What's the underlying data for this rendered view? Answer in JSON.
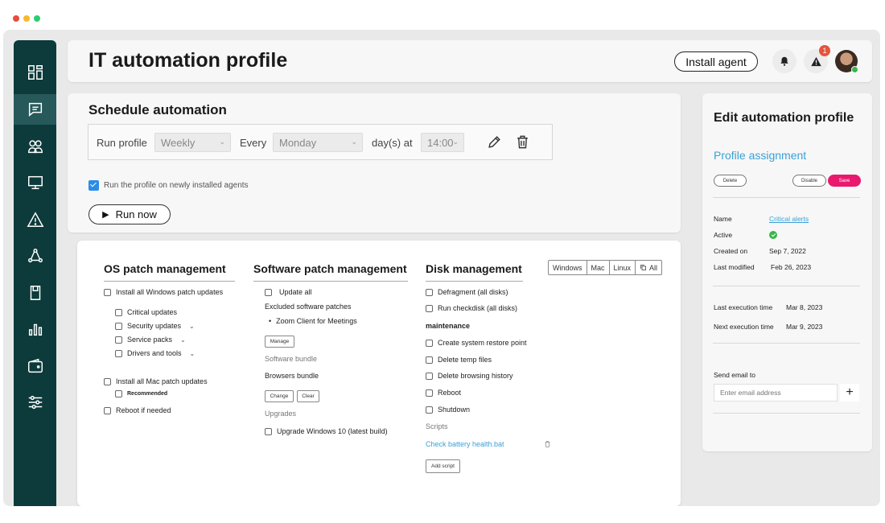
{
  "window": {
    "dot_colors": [
      "#e84c3d",
      "#f5b82e",
      "#2ecc71"
    ]
  },
  "sidebar": {
    "items": [
      {
        "name": "dashboard-icon",
        "active": false
      },
      {
        "name": "chat-icon",
        "active": true
      },
      {
        "name": "users-icon",
        "active": false
      },
      {
        "name": "monitor-icon",
        "active": false
      },
      {
        "name": "alert-icon",
        "active": false
      },
      {
        "name": "network-icon",
        "active": false
      },
      {
        "name": "storage-icon",
        "active": false
      },
      {
        "name": "reports-icon",
        "active": false
      },
      {
        "name": "wallet-icon",
        "active": false
      },
      {
        "name": "settings-sliders-icon",
        "active": false
      }
    ]
  },
  "header": {
    "title": "IT automation profile",
    "install_label": "Install agent",
    "alert_badge": "1"
  },
  "schedule": {
    "title": "Schedule automation",
    "run_profile_label": "Run profile",
    "frequency": "Weekly",
    "every_label": "Every",
    "day": "Monday",
    "days_at_label": "day(s) at",
    "time": "14:00",
    "checkbox_label": "Run the profile on newly installed agents",
    "run_now_label": "Run now"
  },
  "os_patch": {
    "title": "OS patch management",
    "install_windows": "Install all Windows patch updates",
    "critical": "Critical updates",
    "security": "Security updates",
    "service_packs": "Service packs",
    "drivers": "Drivers and tools",
    "install_mac": "Install all Mac patch updates",
    "recommended": "Recommended",
    "reboot": "Reboot if needed"
  },
  "software_patch": {
    "title": "Software patch management",
    "update_all": "Update all",
    "excluded_label": "Excluded software patches",
    "excluded_item": "Zoom Client for Meetings",
    "manage_label": "Manage",
    "bundle_label": "Software bundle",
    "bundle_value": "Browsers bundle",
    "change_label": "Change",
    "clear_label": "Clear",
    "upgrades_label": "Upgrades",
    "upgrade_item": "Upgrade Windows 10 (latest build)"
  },
  "disk": {
    "title": "Disk management",
    "defragment": "Defragment (all disks)",
    "checkdisk": "Run checkdisk (all disks)",
    "maintenance_label": "maintenance",
    "restore_point": "Create system restore point",
    "temp_files": "Delete temp files",
    "browsing_history": "Delete browsing history",
    "reboot": "Reboot",
    "shutdown": "Shutdown",
    "scripts_label": "Scripts",
    "script_file": "Check battery health.bat",
    "add_script": "Add script"
  },
  "os_filter": {
    "windows": "Windows",
    "mac": "Mac",
    "linux": "Linux",
    "all": "All"
  },
  "edit_panel": {
    "title": "Edit automation profile",
    "subtitle": "Profile assignment",
    "delete_label": "Delete",
    "disable_label": "Disable",
    "save_label": "Save",
    "name_key": "Name",
    "name_value": "Critical alerts",
    "active_key": "Active",
    "created_key": "Created on",
    "created_value": "Sep 7, 2022",
    "modified_key": "Last modified",
    "modified_value": "Feb 26, 2023",
    "last_exec_key": "Last execution time",
    "last_exec_value": "Mar 8, 2023",
    "next_exec_key": "Next execution time",
    "next_exec_value": "Mar 9, 2023",
    "send_email_label": "Send email to",
    "email_placeholder": "Enter email address",
    "plus_label": "+"
  },
  "colors": {
    "sidebar": "#0d3a3a",
    "accent_blue": "#3aa0d8",
    "save_pink": "#e8196e",
    "active_green": "#3bb54a"
  }
}
